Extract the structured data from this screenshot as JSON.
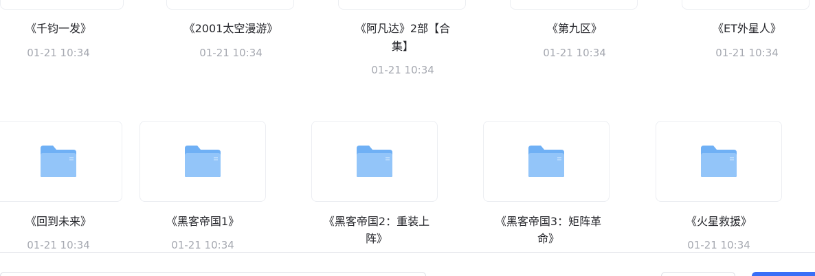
{
  "colors": {
    "folder_front": "#93c5f9",
    "folder_back": "#6fb0f5",
    "primary": "#3a6ff7"
  },
  "folders_row1": [
    {
      "name": "《千钧一发》",
      "date": "01-21 10:34",
      "icon": "folder-icon"
    },
    {
      "name": "《2001太空漫游》",
      "date": "01-21 10:34",
      "icon": "folder-icon"
    },
    {
      "name_line1": "《阿凡达》2部【合",
      "name_line2": "集】",
      "date": "01-21 10:34",
      "icon": "folder-icon"
    },
    {
      "name": "《第九区》",
      "date": "01-21 10:34",
      "icon": "folder-icon"
    },
    {
      "name": "《ET外星人》",
      "date": "01-21 10:34",
      "icon": "folder-icon"
    }
  ],
  "folders_row2": [
    {
      "name": "《回到未来》",
      "date": "01-21 10:34",
      "icon": "folder-icon"
    },
    {
      "name": "《黑客帝国1》",
      "date": "01-21 10:34",
      "icon": "folder-icon"
    },
    {
      "name_line1": "《黑客帝国2：重装上",
      "name_line2": "阵》",
      "icon": "folder-icon"
    },
    {
      "name_line1": "《黑客帝国3：矩阵革",
      "name_line2": "命》",
      "icon": "folder-icon"
    },
    {
      "name": "《火星救援》",
      "date": "01-21 10:34",
      "icon": "folder-icon"
    }
  ]
}
